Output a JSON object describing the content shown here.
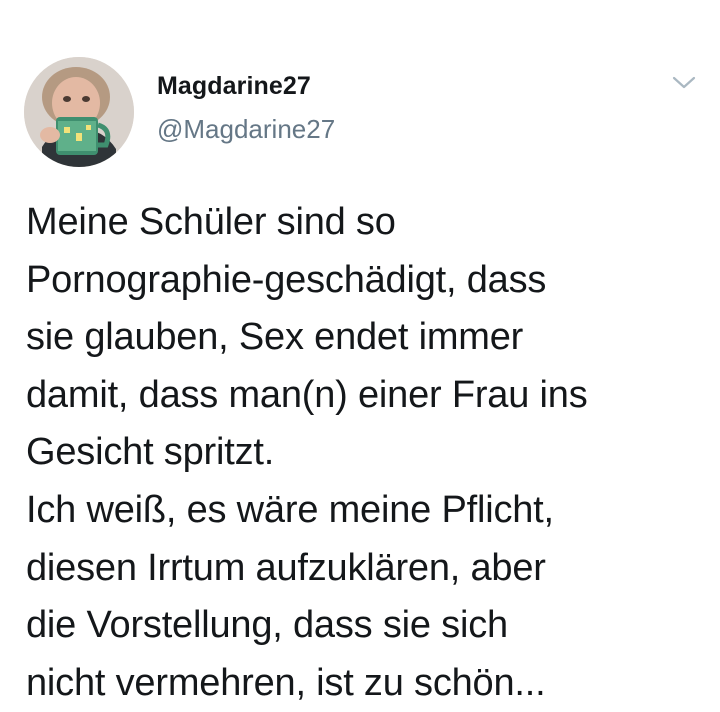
{
  "tweet": {
    "author": {
      "display_name": "Magdarine27",
      "handle": "@Magdarine27",
      "avatar_icon": "profile-photo"
    },
    "menu_icon": "chevron-down-icon",
    "text": "Meine Schüler sind so\nPornographie-geschädigt, dass\nsie glauben, Sex endet immer\ndamit, dass man(n) einer Frau ins\nGesicht spritzt.\nIch weiß, es wäre meine Pflicht,\ndiesen Irrtum aufzuklären, aber\ndie Vorstellung, dass sie sich\nnicht vermehren, ist zu schön..."
  },
  "colors": {
    "text": "#14171a",
    "secondary": "#657786",
    "background": "#ffffff",
    "chevron": "#aab8c2"
  }
}
